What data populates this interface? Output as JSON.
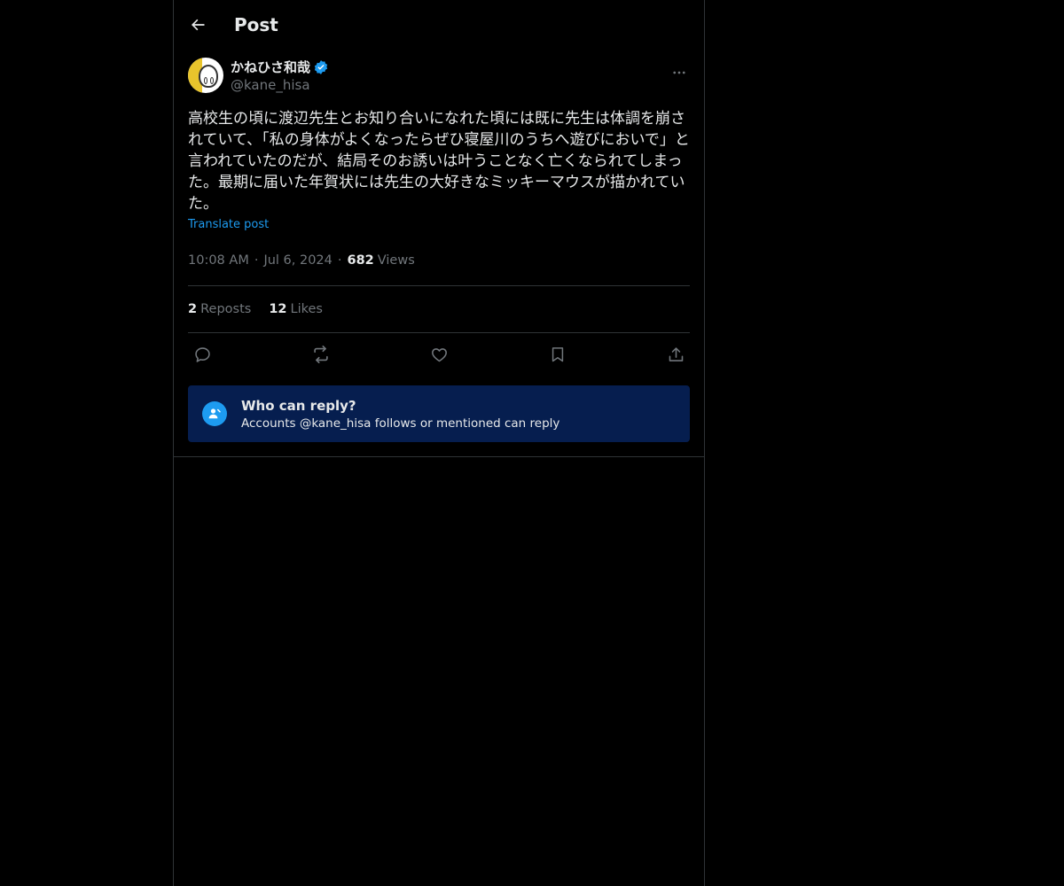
{
  "header": {
    "title": "Post"
  },
  "author": {
    "display_name": "かねひさ和哉",
    "handle": "@kane_hisa",
    "verified": true
  },
  "post": {
    "text": "高校生の頃に渡辺先生とお知り合いになれた頃には既に先生は体調を崩されていて、「私の身体がよくなったらぜひ寝屋川のうちへ遊びにおいで」と言われていたのだが、結局そのお誘いは叶うことなく亡くなられてしまった。最期に届いた年賀状には先生の大好きなミッキーマウスが描かれていた。",
    "translate_label": "Translate post",
    "time": "10:08 AM",
    "date": "Jul 6, 2024",
    "separator": "·",
    "views_count": "682",
    "views_label": "Views"
  },
  "stats": {
    "reposts_count": "2",
    "reposts_label": "Reposts",
    "likes_count": "12",
    "likes_label": "Likes"
  },
  "actions": [
    "reply-icon",
    "repost-icon",
    "like-icon",
    "bookmark-icon",
    "share-icon"
  ],
  "reply_restriction": {
    "title": "Who can reply?",
    "subtitle": "Accounts @kane_hisa follows or mentioned can reply"
  },
  "colors": {
    "background": "#000000",
    "text": "#e7e9ea",
    "muted": "#71767b",
    "accent": "#1d9bf0",
    "reply_box": "#061e4f"
  }
}
